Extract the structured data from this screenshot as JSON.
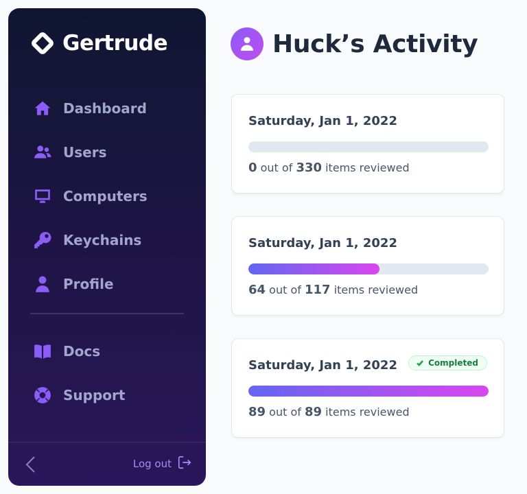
{
  "app": {
    "name": "Gertrude"
  },
  "sidebar": {
    "items": [
      {
        "label": "Dashboard",
        "icon": "home-icon"
      },
      {
        "label": "Users",
        "icon": "users-icon"
      },
      {
        "label": "Computers",
        "icon": "desktop-icon"
      },
      {
        "label": "Keychains",
        "icon": "key-icon"
      },
      {
        "label": "Profile",
        "icon": "user-icon"
      }
    ],
    "secondary_items": [
      {
        "label": "Docs",
        "icon": "book-icon"
      },
      {
        "label": "Support",
        "icon": "lifebuoy-icon"
      }
    ],
    "logout_label": "Log out"
  },
  "page": {
    "title": "Huck’s Activity"
  },
  "days": [
    {
      "date": "Saturday, Jan 1, 2022",
      "reviewed": "0",
      "total": "330",
      "progress": 0,
      "completed": false
    },
    {
      "date": "Saturday, Jan 1, 2022",
      "reviewed": "64",
      "total": "117",
      "progress": 0.547,
      "completed": false
    },
    {
      "date": "Saturday, Jan 1, 2022",
      "reviewed": "89",
      "total": "89",
      "progress": 1.0,
      "completed": true,
      "badge": "Completed"
    }
  ],
  "text": {
    "out_of": "out of",
    "items_reviewed": "items reviewed"
  },
  "colors": {
    "accent": "#8b5cf6",
    "progress_start": "#6366f1",
    "progress_end": "#d946ef",
    "success": "#15803d"
  }
}
